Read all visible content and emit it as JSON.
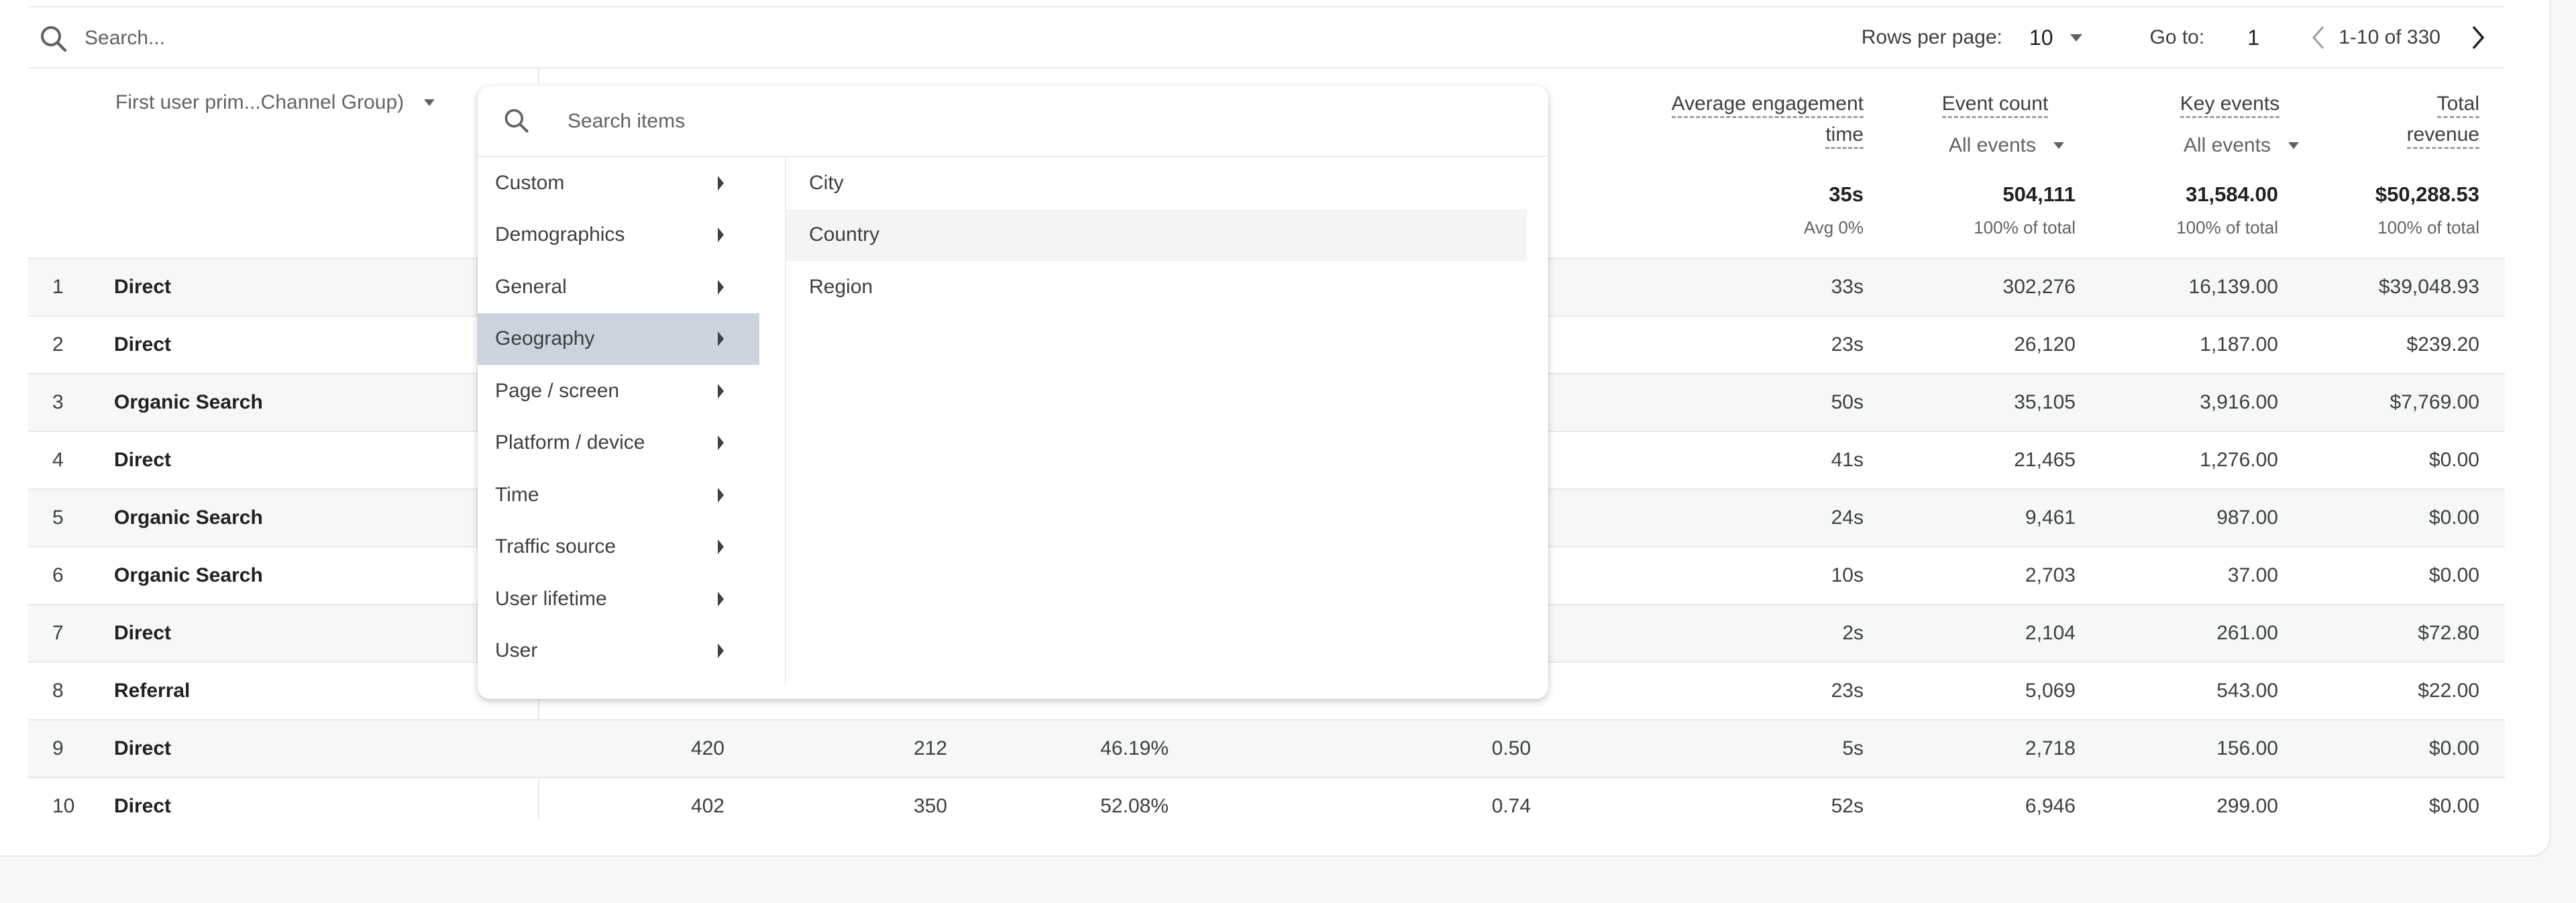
{
  "toolbar": {
    "search_placeholder": "Search...",
    "rows_per_page_label": "Rows per page:",
    "rows_per_page_value": "10",
    "goto_label": "Go to:",
    "goto_value": "1",
    "range_text": "1-10 of 330"
  },
  "table": {
    "dimension_header": "First user prim...Channel Group)",
    "columns": [
      {
        "line1": "Average engagement",
        "line2": "time",
        "line2_type": "label"
      },
      {
        "line1": "Event count",
        "line2": "All events",
        "line2_type": "select"
      },
      {
        "line1": "Key events",
        "line2": "All events",
        "line2_type": "select"
      },
      {
        "line1": "Total",
        "line2": "revenue",
        "line2_type": "label"
      }
    ],
    "totals": [
      {
        "value": "35s",
        "sub": "Avg 0%"
      },
      {
        "value": "504,111",
        "sub": "100% of total"
      },
      {
        "value": "31,584.00",
        "sub": "100% of total"
      },
      {
        "value": "$50,288.53",
        "sub": "100% of total"
      }
    ],
    "rows": [
      {
        "idx": "1",
        "name": "Direct",
        "c1": "",
        "c2": "",
        "c3": "",
        "c4": "",
        "eng": "33s",
        "events": "302,276",
        "key": "16,139.00",
        "rev": "$39,048.93"
      },
      {
        "idx": "2",
        "name": "Direct",
        "c1": "",
        "c2": "",
        "c3": "",
        "c4": "",
        "eng": "23s",
        "events": "26,120",
        "key": "1,187.00",
        "rev": "$239.20"
      },
      {
        "idx": "3",
        "name": "Organic Search",
        "c1": "",
        "c2": "",
        "c3": "",
        "c4": "",
        "eng": "50s",
        "events": "35,105",
        "key": "3,916.00",
        "rev": "$7,769.00"
      },
      {
        "idx": "4",
        "name": "Direct",
        "c1": "",
        "c2": "",
        "c3": "",
        "c4": "",
        "eng": "41s",
        "events": "21,465",
        "key": "1,276.00",
        "rev": "$0.00"
      },
      {
        "idx": "5",
        "name": "Organic Search",
        "c1": "",
        "c2": "",
        "c3": "",
        "c4": "",
        "eng": "24s",
        "events": "9,461",
        "key": "987.00",
        "rev": "$0.00"
      },
      {
        "idx": "6",
        "name": "Organic Search",
        "c1": "",
        "c2": "",
        "c3": "",
        "c4": "",
        "eng": "10s",
        "events": "2,703",
        "key": "37.00",
        "rev": "$0.00"
      },
      {
        "idx": "7",
        "name": "Direct",
        "c1": "",
        "c2": "",
        "c3": "",
        "c4": "",
        "eng": "2s",
        "events": "2,104",
        "key": "261.00",
        "rev": "$72.80"
      },
      {
        "idx": "8",
        "name": "Referral",
        "c1": "",
        "c2": "",
        "c3": "",
        "c4": "",
        "eng": "23s",
        "events": "5,069",
        "key": "543.00",
        "rev": "$22.00"
      },
      {
        "idx": "9",
        "name": "Direct",
        "c1": "420",
        "c2": "212",
        "c3": "46.19%",
        "c4": "0.50",
        "eng": "5s",
        "events": "2,718",
        "key": "156.00",
        "rev": "$0.00"
      },
      {
        "idx": "10",
        "name": "Direct",
        "c1": "402",
        "c2": "350",
        "c3": "52.08%",
        "c4": "0.74",
        "eng": "52s",
        "events": "6,946",
        "key": "299.00",
        "rev": "$0.00"
      }
    ]
  },
  "dropdown": {
    "search_placeholder": "Search items",
    "categories": [
      "Custom",
      "Demographics",
      "General",
      "Geography",
      "Page / screen",
      "Platform / device",
      "Time",
      "Traffic source",
      "User lifetime",
      "User"
    ],
    "selected_category": "Geography",
    "sub_items": [
      "City",
      "Country",
      "Region"
    ],
    "hovered_sub_item": "Country"
  },
  "colors": {
    "selected_category_bg": "#cdd3de",
    "alt_row_bg": "#f6f8f8",
    "hover_bg": "#f4f4f4"
  }
}
